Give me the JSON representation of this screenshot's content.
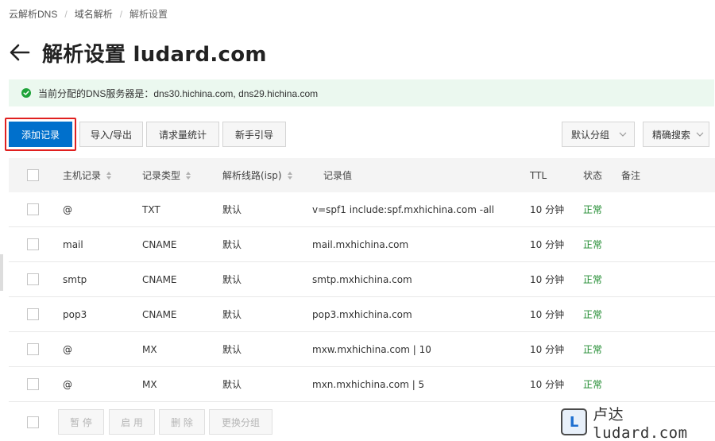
{
  "breadcrumb": [
    "云解析DNS",
    "域名解析",
    "解析设置"
  ],
  "page": {
    "title": "解析设置 ludard.com"
  },
  "notice": {
    "text": "当前分配的DNS服务器是：dns30.hichina.com, dns29.hichina.com"
  },
  "toolbar": {
    "add": "添加记录",
    "import_export": "导入/导出",
    "request_stats": "请求量统计",
    "guide": "新手引导",
    "group_select": "默认分组",
    "precise_search": "精确搜索"
  },
  "columns": {
    "host": "主机记录",
    "type": "记录类型",
    "line": "解析线路(isp)",
    "value": "记录值",
    "ttl": "TTL",
    "status": "状态",
    "remark": "备注"
  },
  "records": [
    {
      "host": "@",
      "type": "TXT",
      "line": "默认",
      "value": "v=spf1 include:spf.mxhichina.com -all",
      "ttl": "10 分钟",
      "status": "正常",
      "remark": ""
    },
    {
      "host": "mail",
      "type": "CNAME",
      "line": "默认",
      "value": "mail.mxhichina.com",
      "ttl": "10 分钟",
      "status": "正常",
      "remark": ""
    },
    {
      "host": "smtp",
      "type": "CNAME",
      "line": "默认",
      "value": "smtp.mxhichina.com",
      "ttl": "10 分钟",
      "status": "正常",
      "remark": ""
    },
    {
      "host": "pop3",
      "type": "CNAME",
      "line": "默认",
      "value": "pop3.mxhichina.com",
      "ttl": "10 分钟",
      "status": "正常",
      "remark": ""
    },
    {
      "host": "@",
      "type": "MX",
      "line": "默认",
      "value": "mxw.mxhichina.com | 10",
      "ttl": "10 分钟",
      "status": "正常",
      "remark": ""
    },
    {
      "host": "@",
      "type": "MX",
      "line": "默认",
      "value": "mxn.mxhichina.com | 5",
      "ttl": "10 分钟",
      "status": "正常",
      "remark": ""
    }
  ],
  "batch": {
    "pause": "暂 停",
    "enable": "启 用",
    "delete": "删 除",
    "change_group": "更换分组"
  },
  "watermark": {
    "logo_letter": "L",
    "text": "卢达ludard.com"
  },
  "colors": {
    "primary": "#0070cc",
    "highlight": "#e0201f",
    "success": "#1d8a2e",
    "notice_bg": "#ebf8ef"
  },
  "icons": {
    "back": "arrow-left-icon",
    "notice": "check-circle-icon",
    "sort": "sort-icon",
    "dropdown": "chevron-down-icon"
  }
}
